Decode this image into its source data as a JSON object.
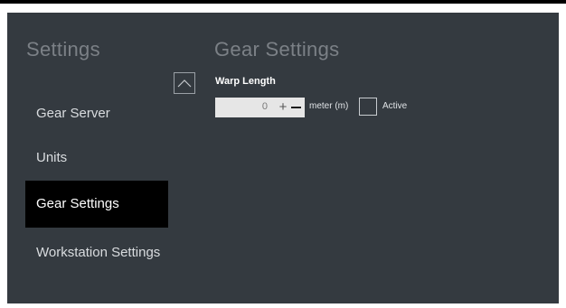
{
  "sidebar": {
    "title": "Settings",
    "items": [
      {
        "label": "Gear Server"
      },
      {
        "label": "Units"
      },
      {
        "label": "Gear Settings",
        "active": true
      },
      {
        "label": "Workstation Settings"
      }
    ],
    "collapse_icon": "chevron-up-icon"
  },
  "main": {
    "title": "Gear Settings",
    "warp_length": {
      "label": "Warp Length",
      "value": "0",
      "increment_label": "+",
      "decrement_icon": "minus-icon",
      "unit": "meter (m)",
      "active_label": "Active",
      "active_checked": false
    }
  },
  "colors": {
    "panel_background": "#343a40",
    "active_item_background": "#000000",
    "muted_title": "#7b8086",
    "input_background": "#e6e6e6"
  }
}
